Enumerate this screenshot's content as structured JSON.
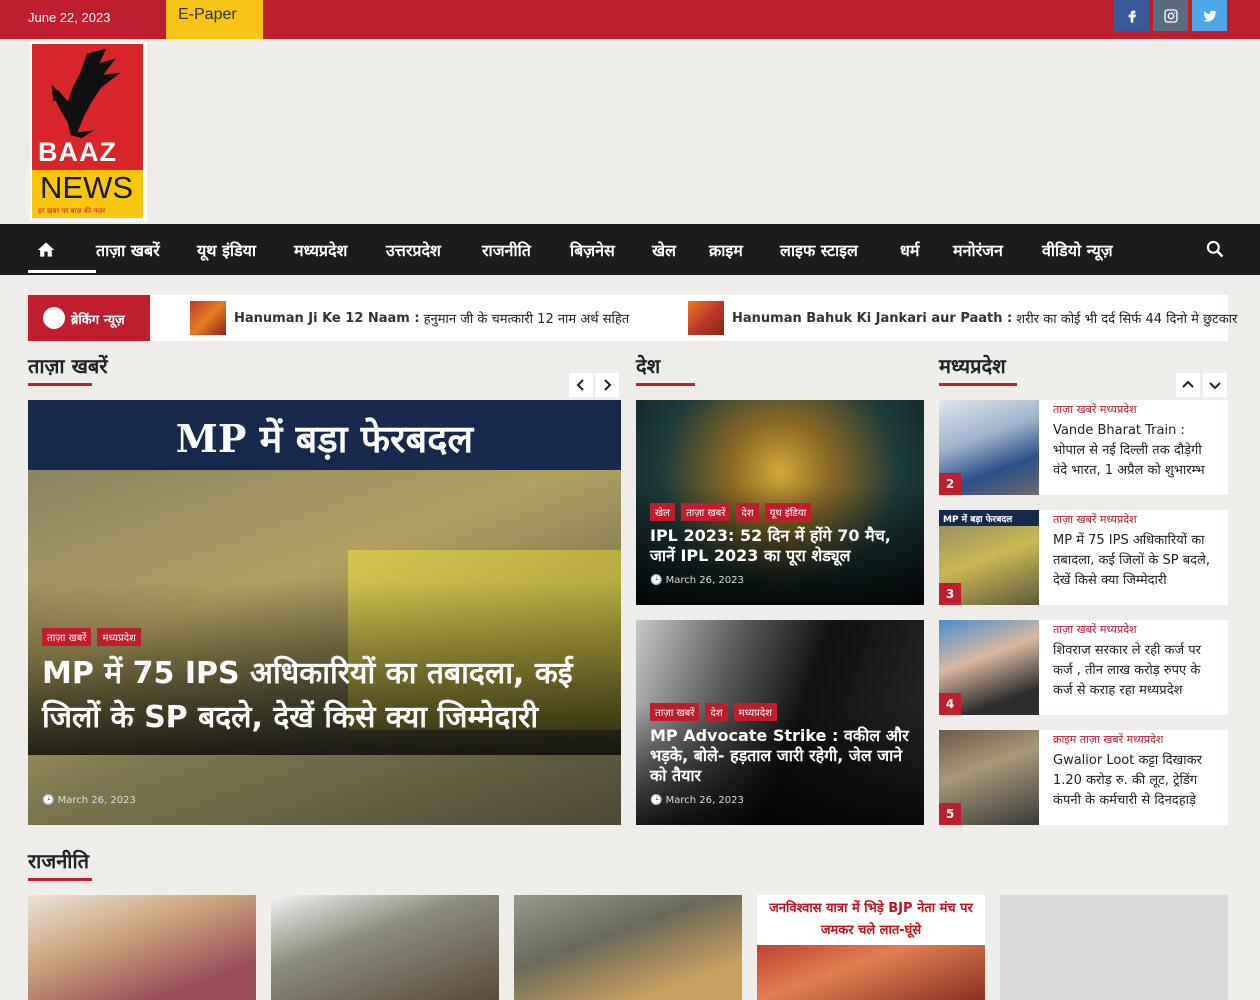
{
  "topbar": {
    "date": "June 22, 2023",
    "epaper": "E-Paper",
    "social": [
      "facebook-icon",
      "instagram-icon",
      "twitter-icon"
    ]
  },
  "logo": {
    "line1": "BAAZ",
    "line2": "NEWS",
    "tagline": "हर खबर पर बाज़ की नज़र"
  },
  "nav": {
    "items": [
      "ताज़ा खबरें",
      "यूथ इंडिया",
      "मध्यप्रदेश",
      "उत्तरप्रदेश",
      "राजनीति",
      "बिज़नेस",
      "खेल",
      "क्राइम",
      "लाइफ स्टाइल",
      "धर्म",
      "मनोरंजन",
      "वीडियो न्यूज़"
    ]
  },
  "breaking": {
    "label": "ब्रेकिंग न्यूज़",
    "items": [
      {
        "bold": "Hanuman Ji Ke 12 Naam :",
        "text": "हनुमान जी के चमत्कारी 12 नाम अर्थ सहित"
      },
      {
        "bold": "Hanuman Bahuk Ki Jankari aur Paath :",
        "text": "शरीर का कोई भी दर्द सिर्फ 44 दिनो मे छुटकार"
      }
    ]
  },
  "sections": {
    "latest": "ताज़ा खबरें",
    "country": "देश",
    "mp": "मध्यप्रदेश",
    "politics": "राजनीति"
  },
  "featured": {
    "image_banner": "MP में बड़ा फेरबदल",
    "tags": [
      "ताज़ा खबरें",
      "मध्यप्रदेश"
    ],
    "title": "MP में 75 IPS अधिकारियों का तबादला, कई जिलों के SP बदले, देखें किसे क्या जिम्मेदारी",
    "date": "March 26, 2023"
  },
  "country_cards": [
    {
      "tags": [
        "खेल",
        "ताज़ा खबरें",
        "देश",
        "यूथ इंडिया"
      ],
      "title": "IPL 2023: 52 दिन में होंगे 70 मैच, जानें IPL 2023 का पूरा शेड्यूल",
      "date": "March 26, 2023"
    },
    {
      "tags": [
        "ताज़ा खबरें",
        "देश",
        "मध्यप्रदेश"
      ],
      "title": "MP Advocate Strike : वकील और भड़के, बोले- हड़ताल जारी रहेगी, जेल जाने को तैयार",
      "date": "March 26, 2023"
    }
  ],
  "mp_list": [
    {
      "num": "2",
      "cats": "ताज़ा खबरें  मध्यप्रदेश",
      "title": "Vande Bharat Train : भोपाल से नई दिल्ली तक दौड़ेगी वंदे भारत, 1 अप्रैल को शुभारम्भ"
    },
    {
      "num": "3",
      "thumb_label": "MP में बड़ा फेरबदल",
      "cats": "ताज़ा खबरें  मध्यप्रदेश",
      "title": "MP में 75 IPS अधिकारियों का तबादला, कई जिलों के SP बदले, देखें किसे क्या जिम्मेदारी"
    },
    {
      "num": "4",
      "cats": "ताज़ा खबरें  मध्यप्रदेश",
      "title": "शिवराज सरकार ले रही कर्ज पर कर्ज , तीन लाख करोड़ रुपए के कर्ज से कराह रहा मध्यप्रदेश"
    },
    {
      "num": "5",
      "cats": "क्राइम  ताज़ा खबरें  मध्यप्रदेश",
      "title": "Gwalior Loot कट्टा दिखाकर 1.20 करोड़ रु. की लूट, ट्रेडिंग कंपनी के कर्मचारी से दिनदहाड़े"
    }
  ],
  "politics_banner": "जनविश्वास यात्रा में भिड़े BJP नेता मंच पर जमकर चले लात-घूंसे",
  "colors": {
    "brand_red": "#be1e2d",
    "epaper_yellow": "#f6c518",
    "nav_dark": "#1c1c1c"
  }
}
